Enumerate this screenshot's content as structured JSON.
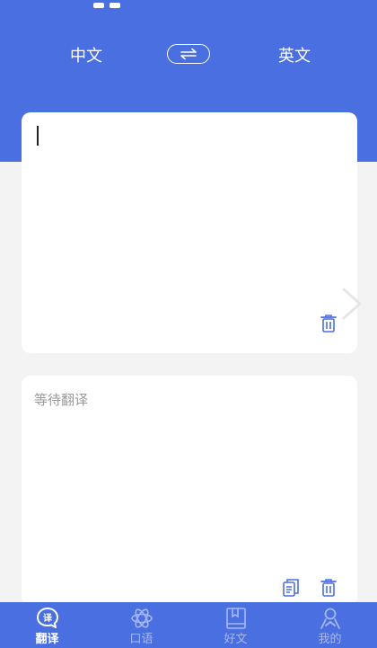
{
  "header": {
    "source_lang": "中文",
    "target_lang": "英文",
    "swap_icon": "swap-arrows-icon",
    "bg_color": "#4a6fe0"
  },
  "input_card": {
    "text": "",
    "delete_icon": "trash-icon"
  },
  "output_card": {
    "placeholder": "等待翻译",
    "copy_icon": "copy-icon",
    "delete_icon": "trash-icon"
  },
  "next_icon": "chevron-right-icon",
  "bottom_nav": {
    "items": [
      {
        "label": "翻译",
        "icon": "translate-bubble-icon",
        "active": true
      },
      {
        "label": "口语",
        "icon": "atom-icon",
        "active": false
      },
      {
        "label": "好文",
        "icon": "bookmark-book-icon",
        "active": false
      },
      {
        "label": "我的",
        "icon": "user-icon",
        "active": false
      }
    ]
  }
}
